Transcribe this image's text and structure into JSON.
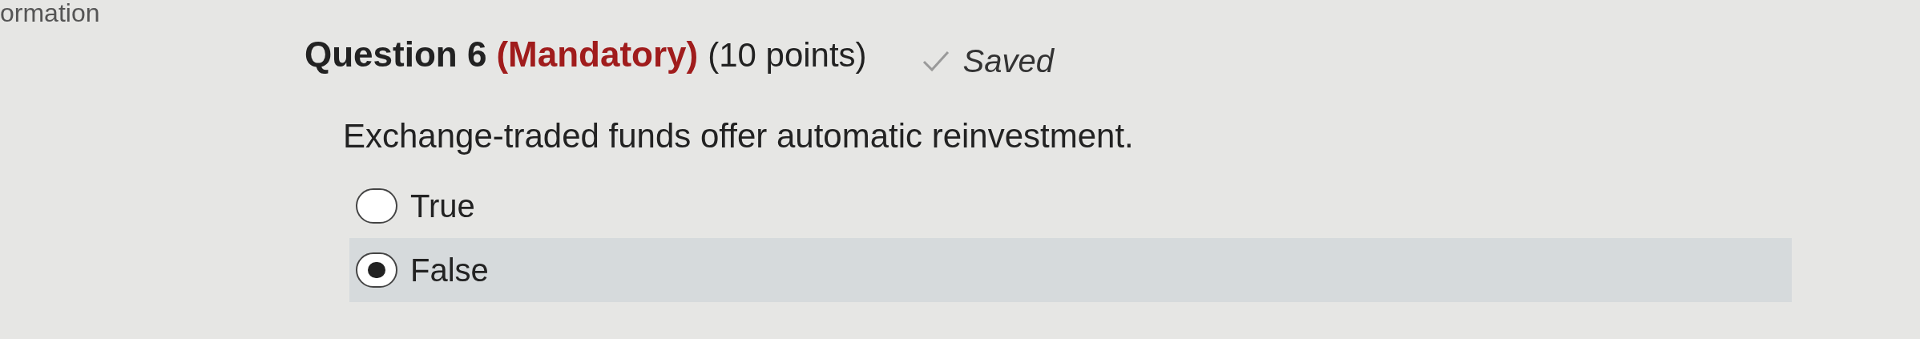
{
  "sidebar": {
    "label": "ormation"
  },
  "question": {
    "title": "Question 6",
    "mandatory": "(Mandatory)",
    "points": "(10 points)",
    "saved": true,
    "saved_label": "Saved",
    "text": "Exchange-traded funds offer automatic reinvestment.",
    "options": [
      {
        "label": "True",
        "selected": false
      },
      {
        "label": "False",
        "selected": true
      }
    ]
  }
}
